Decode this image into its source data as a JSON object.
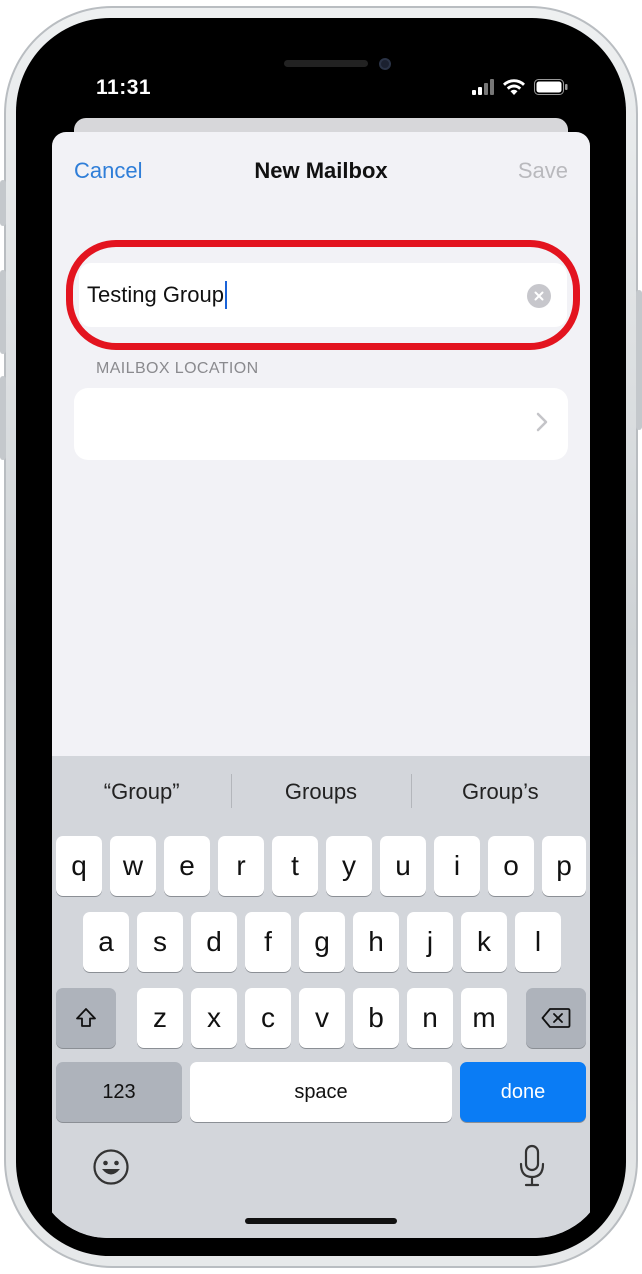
{
  "status_bar": {
    "time": "11:31"
  },
  "nav": {
    "cancel": "Cancel",
    "title": "New Mailbox",
    "save": "Save"
  },
  "name_field": {
    "value": "Testing Group"
  },
  "location": {
    "section_label": "MAILBOX LOCATION"
  },
  "keyboard": {
    "suggestions": [
      "“Group”",
      "Groups",
      "Group’s"
    ],
    "row1": [
      "q",
      "w",
      "e",
      "r",
      "t",
      "y",
      "u",
      "i",
      "o",
      "p"
    ],
    "row2": [
      "a",
      "s",
      "d",
      "f",
      "g",
      "h",
      "j",
      "k",
      "l"
    ],
    "row3": [
      "z",
      "x",
      "c",
      "v",
      "b",
      "n",
      "m"
    ],
    "numbers_label": "123",
    "space_label": "space",
    "done_label": "done"
  },
  "colors": {
    "accent": "#2f7ed8",
    "highlight": "#e3141f",
    "done_key": "#0a7cf5"
  }
}
